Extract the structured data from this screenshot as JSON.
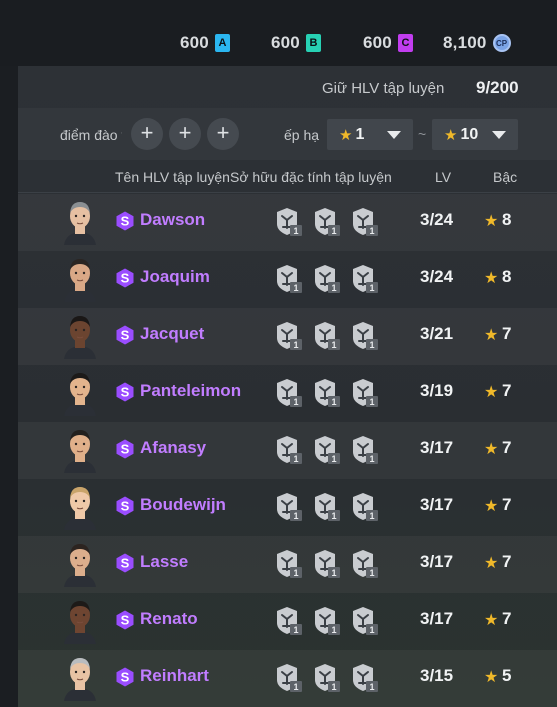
{
  "currencies": [
    {
      "amount": "600",
      "badge": "A",
      "color": "#2bb6f0"
    },
    {
      "amount": "600",
      "badge": "B",
      "color": "#27d1b4"
    },
    {
      "amount": "600",
      "badge": "C",
      "color": "#c23df0"
    },
    {
      "amount": "8,100",
      "badge": "CP",
      "color": "#7aa3e6"
    }
  ],
  "capacity": {
    "label": "Giữ HLV tập luyện",
    "value": "9/200"
  },
  "filters": {
    "points_label": "điểm đào t",
    "rank_label": "ếp hạ",
    "rank_min": "1",
    "rank_max": "10",
    "separator": "~"
  },
  "columns": {
    "name": "Tên HLV tập luyện",
    "traits": "Sở hữu đặc tính tập luyện",
    "lv": "LV",
    "grade": "Bậc"
  },
  "coaches": [
    {
      "name": "Dawson",
      "lv": "3/24",
      "grade": "8",
      "traits": [
        {
          "icon": "crossed-swords-icon",
          "level": "1"
        },
        {
          "icon": "shield-figure-icon",
          "level": "1"
        },
        {
          "icon": "dribble-icon",
          "level": "1"
        }
      ]
    },
    {
      "name": "Joaquim",
      "lv": "3/24",
      "grade": "8",
      "traits": [
        {
          "icon": "scissors-icon",
          "level": "1"
        },
        {
          "icon": "shield-figure-icon",
          "level": "1"
        },
        {
          "icon": "dribble-icon",
          "level": "1"
        }
      ]
    },
    {
      "name": "Jacquet",
      "lv": "3/21",
      "grade": "7",
      "traits": [
        {
          "icon": "shield-figure-icon",
          "level": "1"
        },
        {
          "icon": "goal-icon",
          "level": "1"
        },
        {
          "icon": "dribble-icon",
          "level": "1"
        }
      ]
    },
    {
      "name": "Panteleimon",
      "lv": "3/19",
      "grade": "7",
      "traits": [
        {
          "icon": "goal-icon",
          "level": "1"
        },
        {
          "icon": "tackle-icon",
          "level": "1"
        },
        {
          "icon": "pass-icon",
          "level": "1"
        }
      ]
    },
    {
      "name": "Afanasy",
      "lv": "3/17",
      "grade": "7",
      "traits": [
        {
          "icon": "header-icon",
          "level": "1"
        },
        {
          "icon": "tie-icon",
          "level": "1"
        },
        {
          "icon": "shield-figure-icon",
          "level": "1"
        }
      ]
    },
    {
      "name": "Boudewijn",
      "lv": "3/17",
      "grade": "7",
      "traits": [
        {
          "icon": "header-icon",
          "level": "1"
        },
        {
          "icon": "whistle-icon",
          "level": "1"
        },
        {
          "icon": "shield-icon",
          "level": "1"
        }
      ]
    },
    {
      "name": "Lasse",
      "lv": "3/17",
      "grade": "7",
      "traits": [
        {
          "icon": "header-icon",
          "level": "1"
        },
        {
          "icon": "glove-icon",
          "level": "1"
        },
        {
          "icon": "sprint-icon",
          "level": "1"
        }
      ]
    },
    {
      "name": "Renato",
      "lv": "3/17",
      "grade": "7",
      "traits": [
        {
          "icon": "header-icon",
          "level": "1"
        },
        {
          "icon": "whistle-icon",
          "level": "1"
        },
        {
          "icon": "sprint-icon",
          "level": "1"
        }
      ]
    },
    {
      "name": "Reinhart",
      "lv": "3/15",
      "grade": "5",
      "traits": [
        {
          "icon": "header-icon",
          "level": "1"
        },
        {
          "icon": "tie-icon",
          "level": "1"
        },
        {
          "icon": "pass-icon",
          "level": "1"
        }
      ]
    }
  ]
}
